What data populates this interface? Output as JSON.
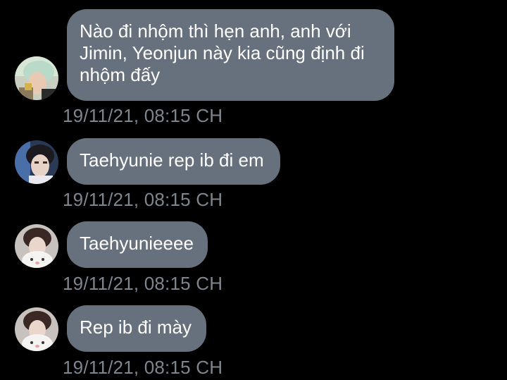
{
  "messages": [
    {
      "text": "Nào đi nhộm thì hẹn anh, anh với\nJimin, Yeonjun này kia cũng định đi\nnhộm đấy",
      "timestamp": "19/11/21, 08:15 CH",
      "avatar": "avatar-user-1"
    },
    {
      "text": "Taehyunie rep ib đi em",
      "timestamp": "19/11/21, 08:15 CH",
      "avatar": "avatar-user-2"
    },
    {
      "text": "Taehyunieeee",
      "timestamp": "19/11/21, 08:15 CH",
      "avatar": "avatar-user-3"
    },
    {
      "text": "Rep ib đi mày",
      "timestamp": "19/11/21, 08:15 CH",
      "avatar": "avatar-user-3"
    }
  ],
  "colors": {
    "background": "#000000",
    "bubble": "#66717d",
    "bubble_text": "#ffffff",
    "timestamp": "#7e858c"
  }
}
